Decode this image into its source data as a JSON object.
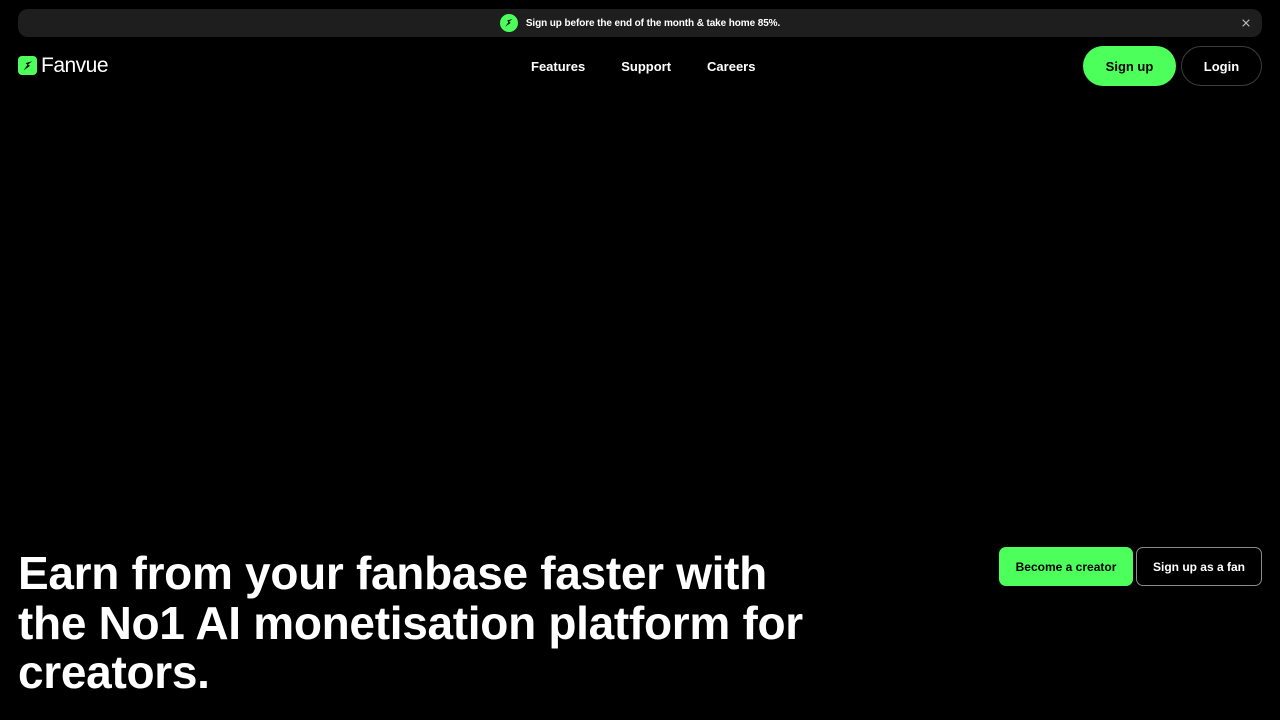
{
  "banner": {
    "text": "Sign up before the end of the month & take home 85%.",
    "icon": "bolt-icon",
    "close_icon": "close-icon"
  },
  "brand": {
    "name": "Fanvue",
    "accent": "#4cff5a"
  },
  "nav": {
    "links": [
      "Features",
      "Support",
      "Careers"
    ],
    "signup_label": "Sign up",
    "login_label": "Login"
  },
  "hero": {
    "title": "Earn from your fanbase faster with the No1 AI monetisation platform for creators.",
    "primary_cta": "Become a creator",
    "secondary_cta": "Sign up as a fan"
  }
}
